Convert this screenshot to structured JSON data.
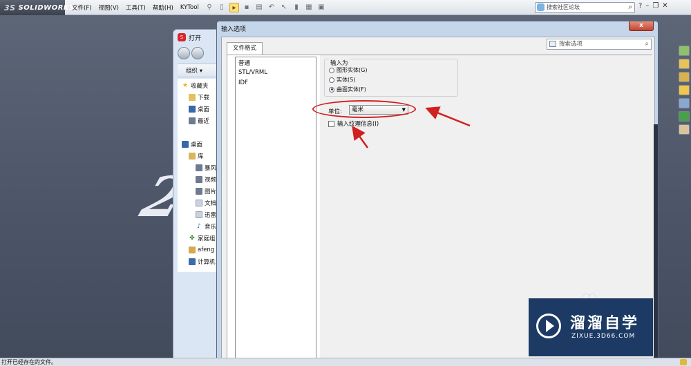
{
  "app": {
    "logo_text": "SOLIDWORKS",
    "logo_prefix": "3S",
    "menu": [
      "文件(F)",
      "视图(V)",
      "工具(T)",
      "帮助(H)",
      "KYTool"
    ],
    "search_placeholder": "搜索社区论坛",
    "help_label": "?",
    "toolbar_icons": [
      "pin-icon",
      "new-doc-icon",
      "open-icon",
      "save-icon",
      "print-icon",
      "undo-icon",
      "select-icon",
      "rebuild-icon",
      "options-icon",
      "layout-icon"
    ]
  },
  "open_dialog": {
    "title": "打开",
    "organize": "组织 ▾",
    "tree": [
      "收藏夹",
      "下载",
      "桌面",
      "最近",
      "桌面",
      "库",
      "暴风",
      "视频",
      "图片",
      "文档",
      "迅雷",
      "音乐",
      "家庭组",
      "afeng",
      "计算机"
    ]
  },
  "input_dialog": {
    "title": "输入选项",
    "close_label": "x",
    "tab_label": "文件格式",
    "search_placeholder": "搜索选项",
    "formats": [
      "普通",
      "STL/VRML",
      "IDF"
    ],
    "group_title": "输入为",
    "import_options": [
      {
        "label": "图形实体(G)",
        "selected": false
      },
      {
        "label": "实体(S)",
        "selected": false
      },
      {
        "label": "曲面实体(F)",
        "selected": true
      }
    ],
    "unit_label": "单位:",
    "unit_value": "毫米",
    "texture_checkbox_label": "输入纹理信息(I)",
    "texture_checked": false
  },
  "status": {
    "text": "打开已经存在的文件。"
  },
  "watermark": {
    "title": "溜溜自学",
    "subtitle": "ZIXUE.3D66.COM"
  },
  "colors": {
    "annotation_red": "#d21f1f",
    "brand_blue": "#1d3a64"
  }
}
